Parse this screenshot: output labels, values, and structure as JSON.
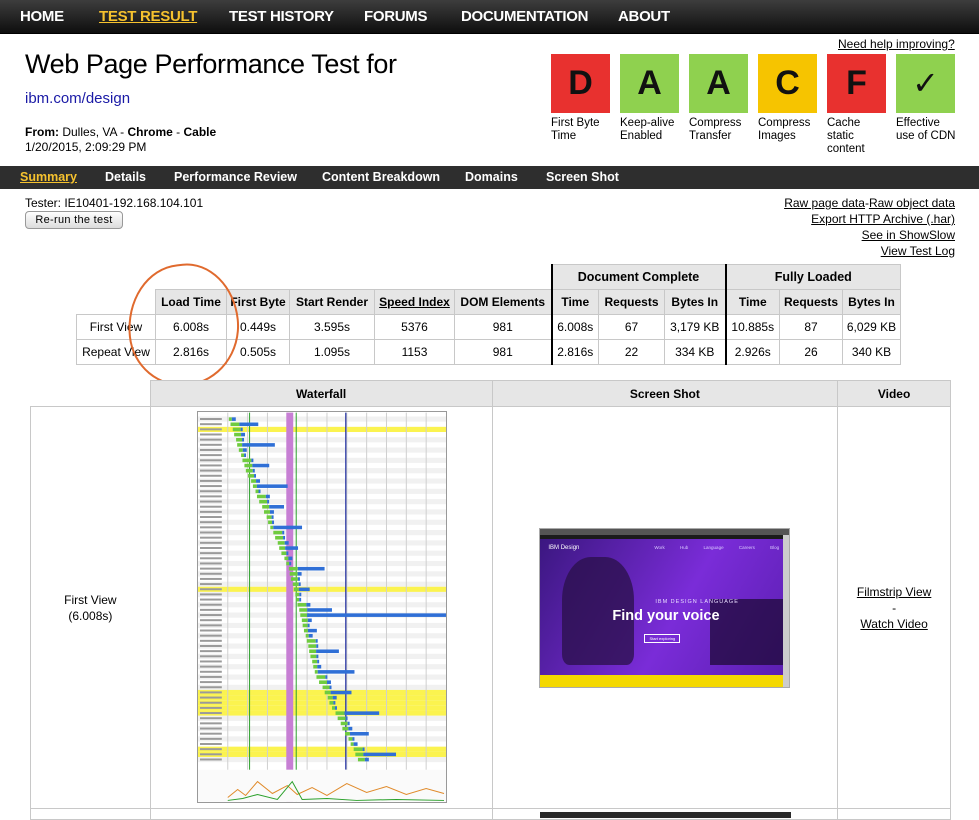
{
  "nav": {
    "items": [
      "HOME",
      "TEST RESULT",
      "TEST HISTORY",
      "FORUMS",
      "DOCUMENTATION",
      "ABOUT"
    ],
    "active": "TEST RESULT"
  },
  "header": {
    "title": "Web Page Performance Test for",
    "url": "ibm.com/design",
    "from_label": "From:",
    "location": "Dulles, VA - ",
    "browser": "Chrome",
    "sep": " - ",
    "connection": "Cable",
    "datetime": "1/20/2015, 2:09:29 PM",
    "help_link": "Need help improving?"
  },
  "grades": [
    {
      "grade": "D",
      "label": "First Byte Time",
      "color": "#e8312f"
    },
    {
      "grade": "A",
      "label": "Keep-alive Enabled",
      "color": "#8fd14f"
    },
    {
      "grade": "A",
      "label": "Compress Transfer",
      "color": "#8fd14f"
    },
    {
      "grade": "C",
      "label": "Compress Images",
      "color": "#f6c400"
    },
    {
      "grade": "F",
      "label": "Cache static content",
      "color": "#e8312f"
    },
    {
      "grade": "✓",
      "label": "Effective use of CDN",
      "color": "#8fd14f"
    }
  ],
  "subnav": {
    "items": [
      "Summary",
      "Details",
      "Performance Review",
      "Content Breakdown",
      "Domains",
      "Screen Shot"
    ],
    "active": "Summary"
  },
  "tester": "Tester: IE10401-192.168.104.101",
  "rerun_button": "Re-run the test",
  "right_links": {
    "raw_page": "Raw page data",
    "dash": " - ",
    "raw_object": "Raw object data",
    "har": "Export HTTP Archive (.har)",
    "showslow": "See in ShowSlow",
    "log": "View Test Log"
  },
  "summary_table": {
    "group_headers": [
      "Document Complete",
      "Fully Loaded"
    ],
    "columns": [
      "Load Time",
      "First Byte",
      "Start Render",
      "Speed Index",
      "DOM Elements",
      "Time",
      "Requests",
      "Bytes In",
      "Time",
      "Requests",
      "Bytes In"
    ],
    "rows": [
      {
        "label": "First View",
        "values": [
          "6.008s",
          "0.449s",
          "3.595s",
          "5376",
          "981",
          "6.008s",
          "67",
          "3,179 KB",
          "10.885s",
          "87",
          "6,029 KB"
        ]
      },
      {
        "label": "Repeat View",
        "values": [
          "2.816s",
          "0.505s",
          "1.095s",
          "1153",
          "981",
          "2.816s",
          "22",
          "334 KB",
          "2.926s",
          "26",
          "340 KB"
        ]
      }
    ]
  },
  "view_table": {
    "headers": [
      "Waterfall",
      "Screen Shot",
      "Video"
    ],
    "row_label_1": "First View",
    "row_label_2": "(6.008s)",
    "filmstrip_link": "Filmstrip View",
    "dash": "-",
    "video_link": "Watch Video"
  },
  "screenshot": {
    "brand": "IBM Design",
    "menu": "Work Hub Language Careers Blog",
    "kicker": "IBM DESIGN LANGUAGE",
    "headline": "Find your voice",
    "cta": "Start exploring"
  }
}
